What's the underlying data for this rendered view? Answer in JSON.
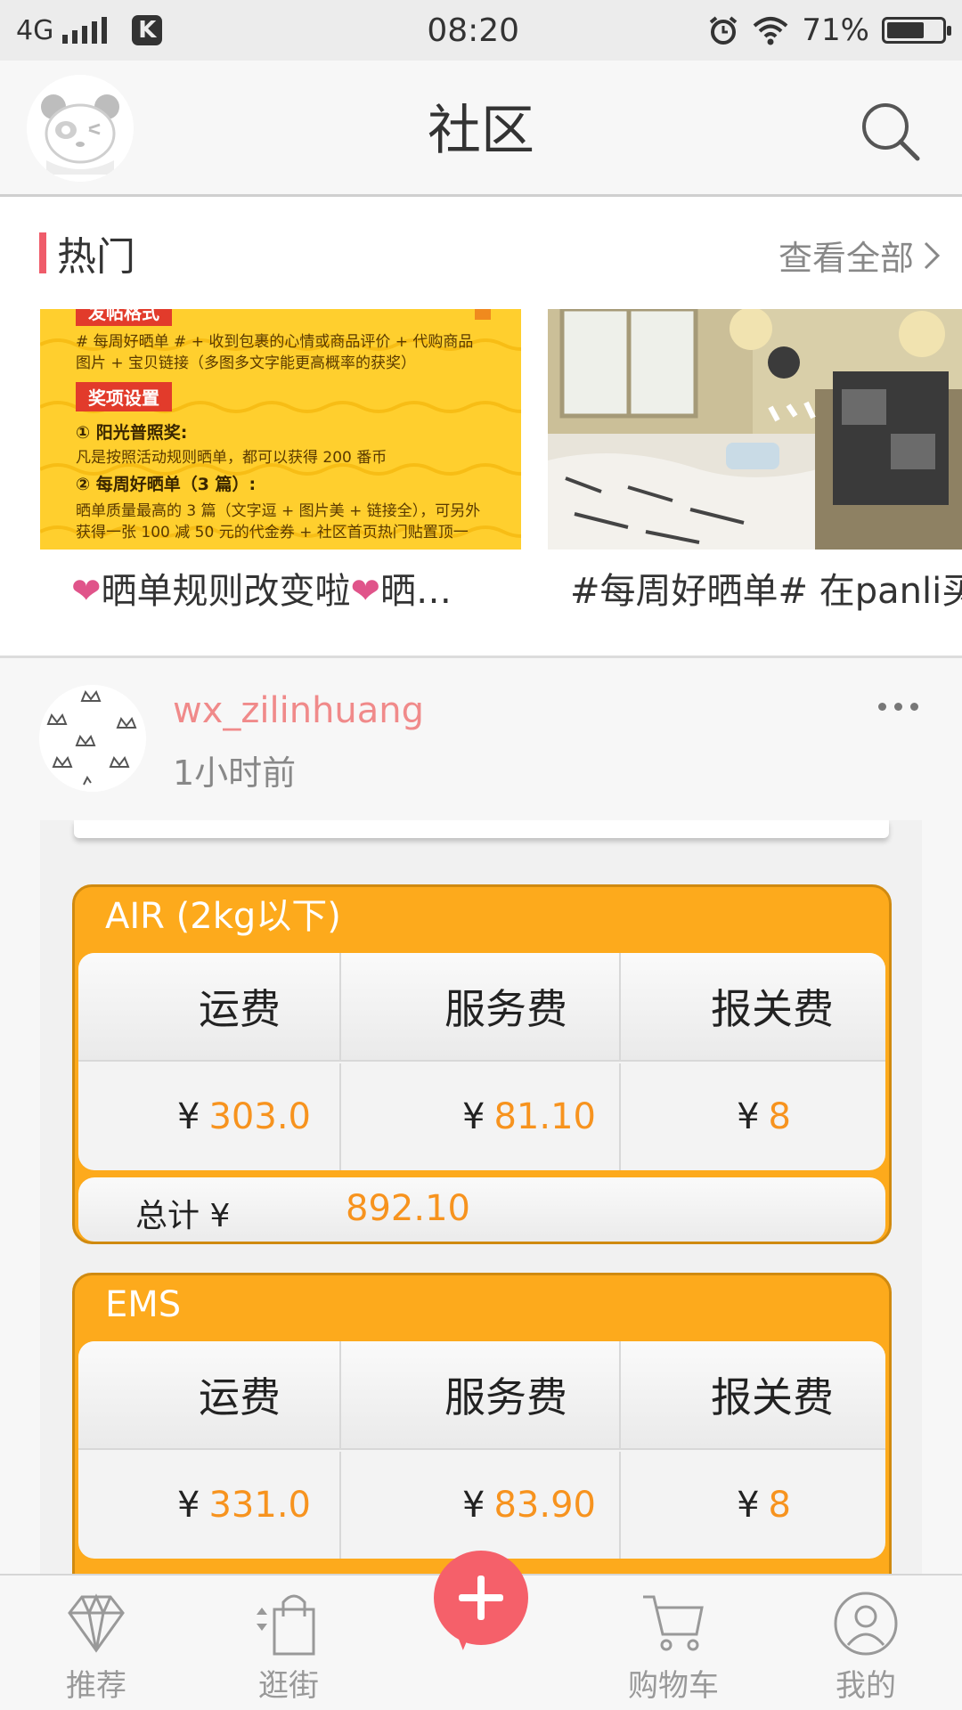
{
  "status_bar": {
    "network": "4G",
    "time": "08:20",
    "battery": "71%",
    "battery_level": 0.71
  },
  "header": {
    "title": "社区"
  },
  "hot": {
    "title": "热门",
    "view_all": "查看全部",
    "cards": [
      {
        "caption_text": "晒单规则改变啦",
        "caption_tail": "晒…",
        "poster": {
          "tag_top": "发帖格式",
          "line1": "# 每周好晒单 # + 收到包裹的心情或商品评价 + 代购商品",
          "line2": "图片 + 宝贝链接（多图多文字能更高概率的获奖）",
          "tag_award": "奖项设置",
          "award1_title": "① 阳光普照奖:",
          "award1_desc": "凡是按照活动规则晒单，都可以获得 200 番币",
          "award2_title": "② 每周好晒单（3 篇）:",
          "award2_desc1": "晒单质量最高的 3 篇（文字逗 + 图片美 + 链接全），可另外",
          "award2_desc2": "获得一张 100 减 50 元的代金券 + 社区首页热门贴置顶一"
        }
      },
      {
        "caption": "#每周好晒单# 在panli买"
      }
    ]
  },
  "post": {
    "username": "wx_zilinhuang",
    "time": "1小时前",
    "boxes": [
      {
        "title": "AIR (2kg以下)",
        "headers": [
          "运费",
          "服务费",
          "报关费"
        ],
        "currency": "¥",
        "values": [
          "303.0",
          "81.10",
          "8"
        ],
        "total_label": "总计 ¥",
        "total": "892.10"
      },
      {
        "title": "EMS",
        "headers": [
          "运费",
          "服务费",
          "报关费"
        ],
        "currency": "¥",
        "values": [
          "331.0",
          "83.90",
          "8"
        ]
      }
    ]
  },
  "tabbar": {
    "tabs": [
      {
        "label": "推荐",
        "icon": "diamond-icon"
      },
      {
        "label": "逛街",
        "icon": "shopping-bag-icon"
      },
      {
        "label": "",
        "icon": "plus-icon"
      },
      {
        "label": "购物车",
        "icon": "cart-icon"
      },
      {
        "label": "我的",
        "icon": "user-icon"
      }
    ]
  },
  "colors": {
    "accent": "#f5606a",
    "username": "#f08a8a",
    "fee_orange": "#fdaa1c",
    "value_orange": "#f7931e"
  }
}
